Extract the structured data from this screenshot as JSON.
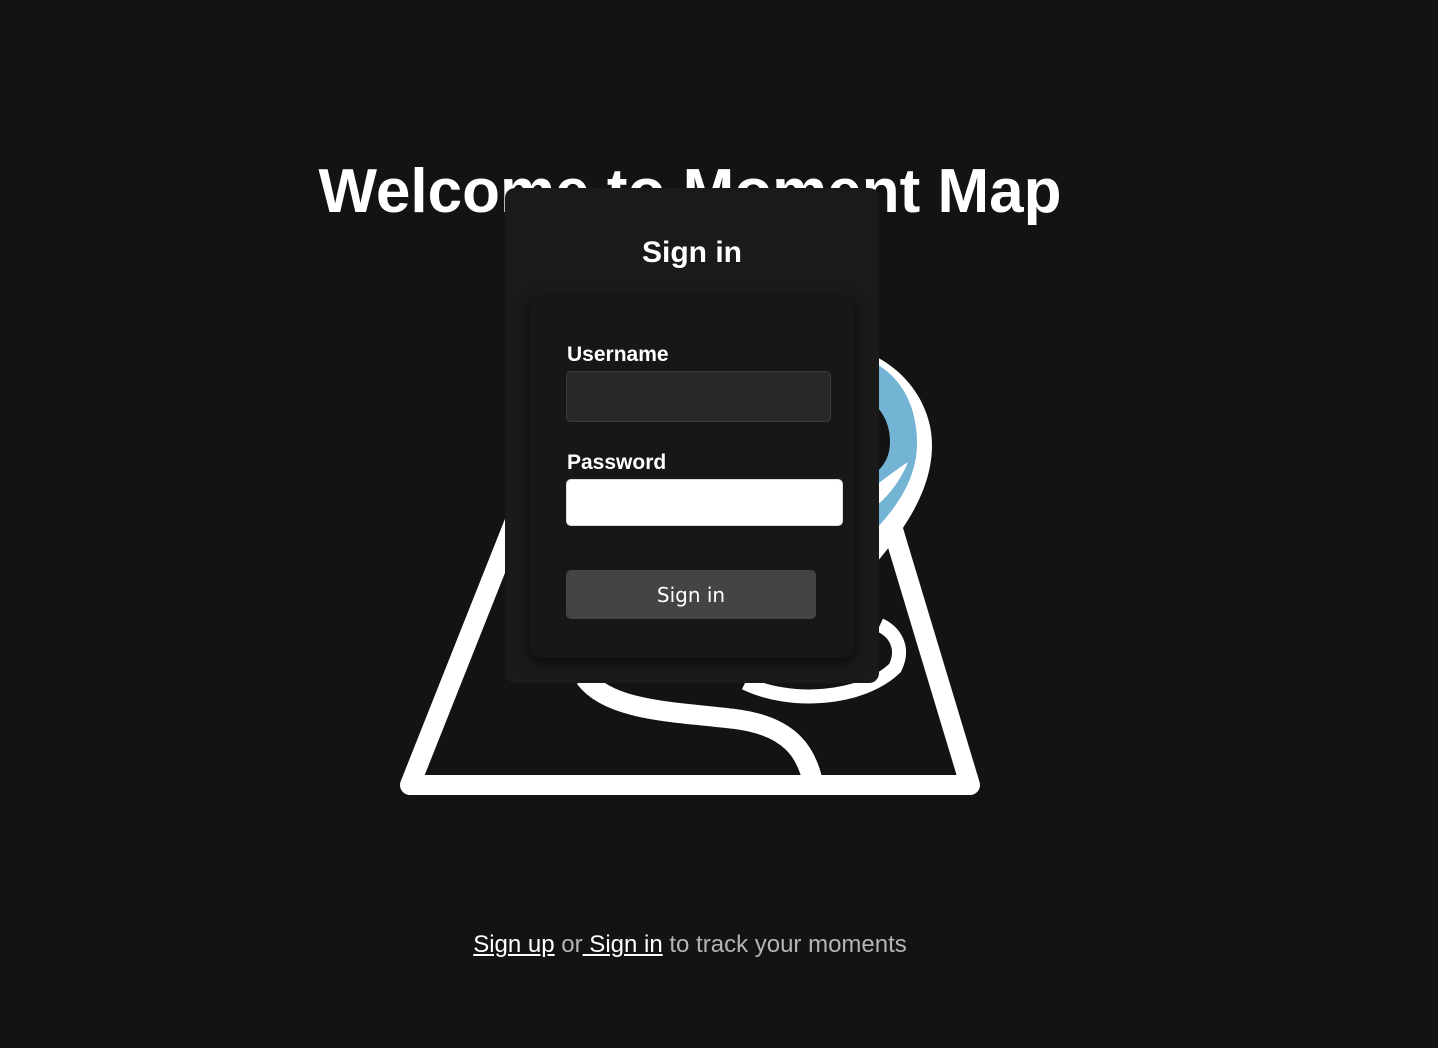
{
  "hero": {
    "title": "Welcome to Moment Map",
    "illustration_icon": "map-pin-icon",
    "pin_accent_color": "#73b3d4"
  },
  "signin_modal": {
    "title": "Sign in",
    "username_label": "Username",
    "username_value": "",
    "password_label": "Password",
    "password_value": "",
    "submit_label": "Sign in"
  },
  "footer": {
    "signup_link": "Sign up",
    "or_text": " or",
    "signin_link": " Sign in",
    "tail_text": " to track your moments"
  },
  "colors": {
    "background": "#131313",
    "modal_background": "#1a1a1a",
    "button_background": "#444444"
  }
}
